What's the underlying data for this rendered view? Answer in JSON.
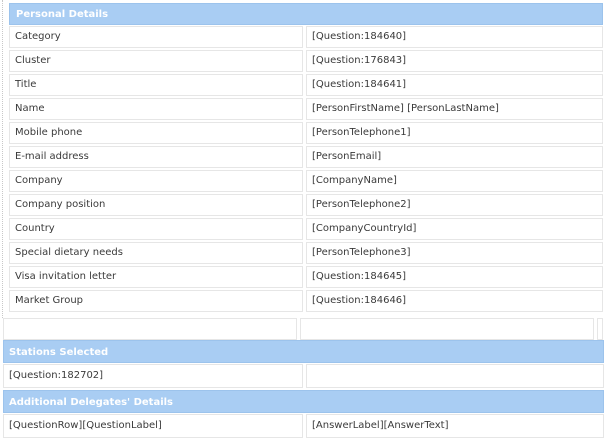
{
  "personal_details": {
    "title": "Personal Details",
    "rows": [
      {
        "label": "Category",
        "value": "[Question:184640]"
      },
      {
        "label": "Cluster",
        "value": "[Question:176843]"
      },
      {
        "label": "Title",
        "value": "[Question:184641]"
      },
      {
        "label": "Name",
        "value": "[PersonFirstName] [PersonLastName]"
      },
      {
        "label": "Mobile phone",
        "value": "[PersonTelephone1]"
      },
      {
        "label": "E-mail address",
        "value": "[PersonEmail]"
      },
      {
        "label": "Company",
        "value": "[CompanyName]"
      },
      {
        "label": "Company position",
        "value": "[PersonTelephone2]"
      },
      {
        "label": "Country",
        "value": "[CompanyCountryId]"
      },
      {
        "label": "Special dietary needs",
        "value": "[PersonTelephone3]"
      },
      {
        "label": "Visa invitation letter",
        "value": "[Question:184645]"
      },
      {
        "label": "Market Group",
        "value": "[Question:184646]"
      }
    ]
  },
  "stations_selected": {
    "title": "Stations Selected",
    "value": "[Question:182702]"
  },
  "additional_delegates": {
    "title": "Additional Delegates' Details",
    "label": "[QuestionRow][QuestionLabel]",
    "value": "[AnswerLabel][AnswerText]"
  },
  "colors": {
    "header_bg": "#a9cdf3",
    "header_text": "#ffffff",
    "cell_border": "#e6e6e6",
    "text": "#3a3a3a"
  }
}
